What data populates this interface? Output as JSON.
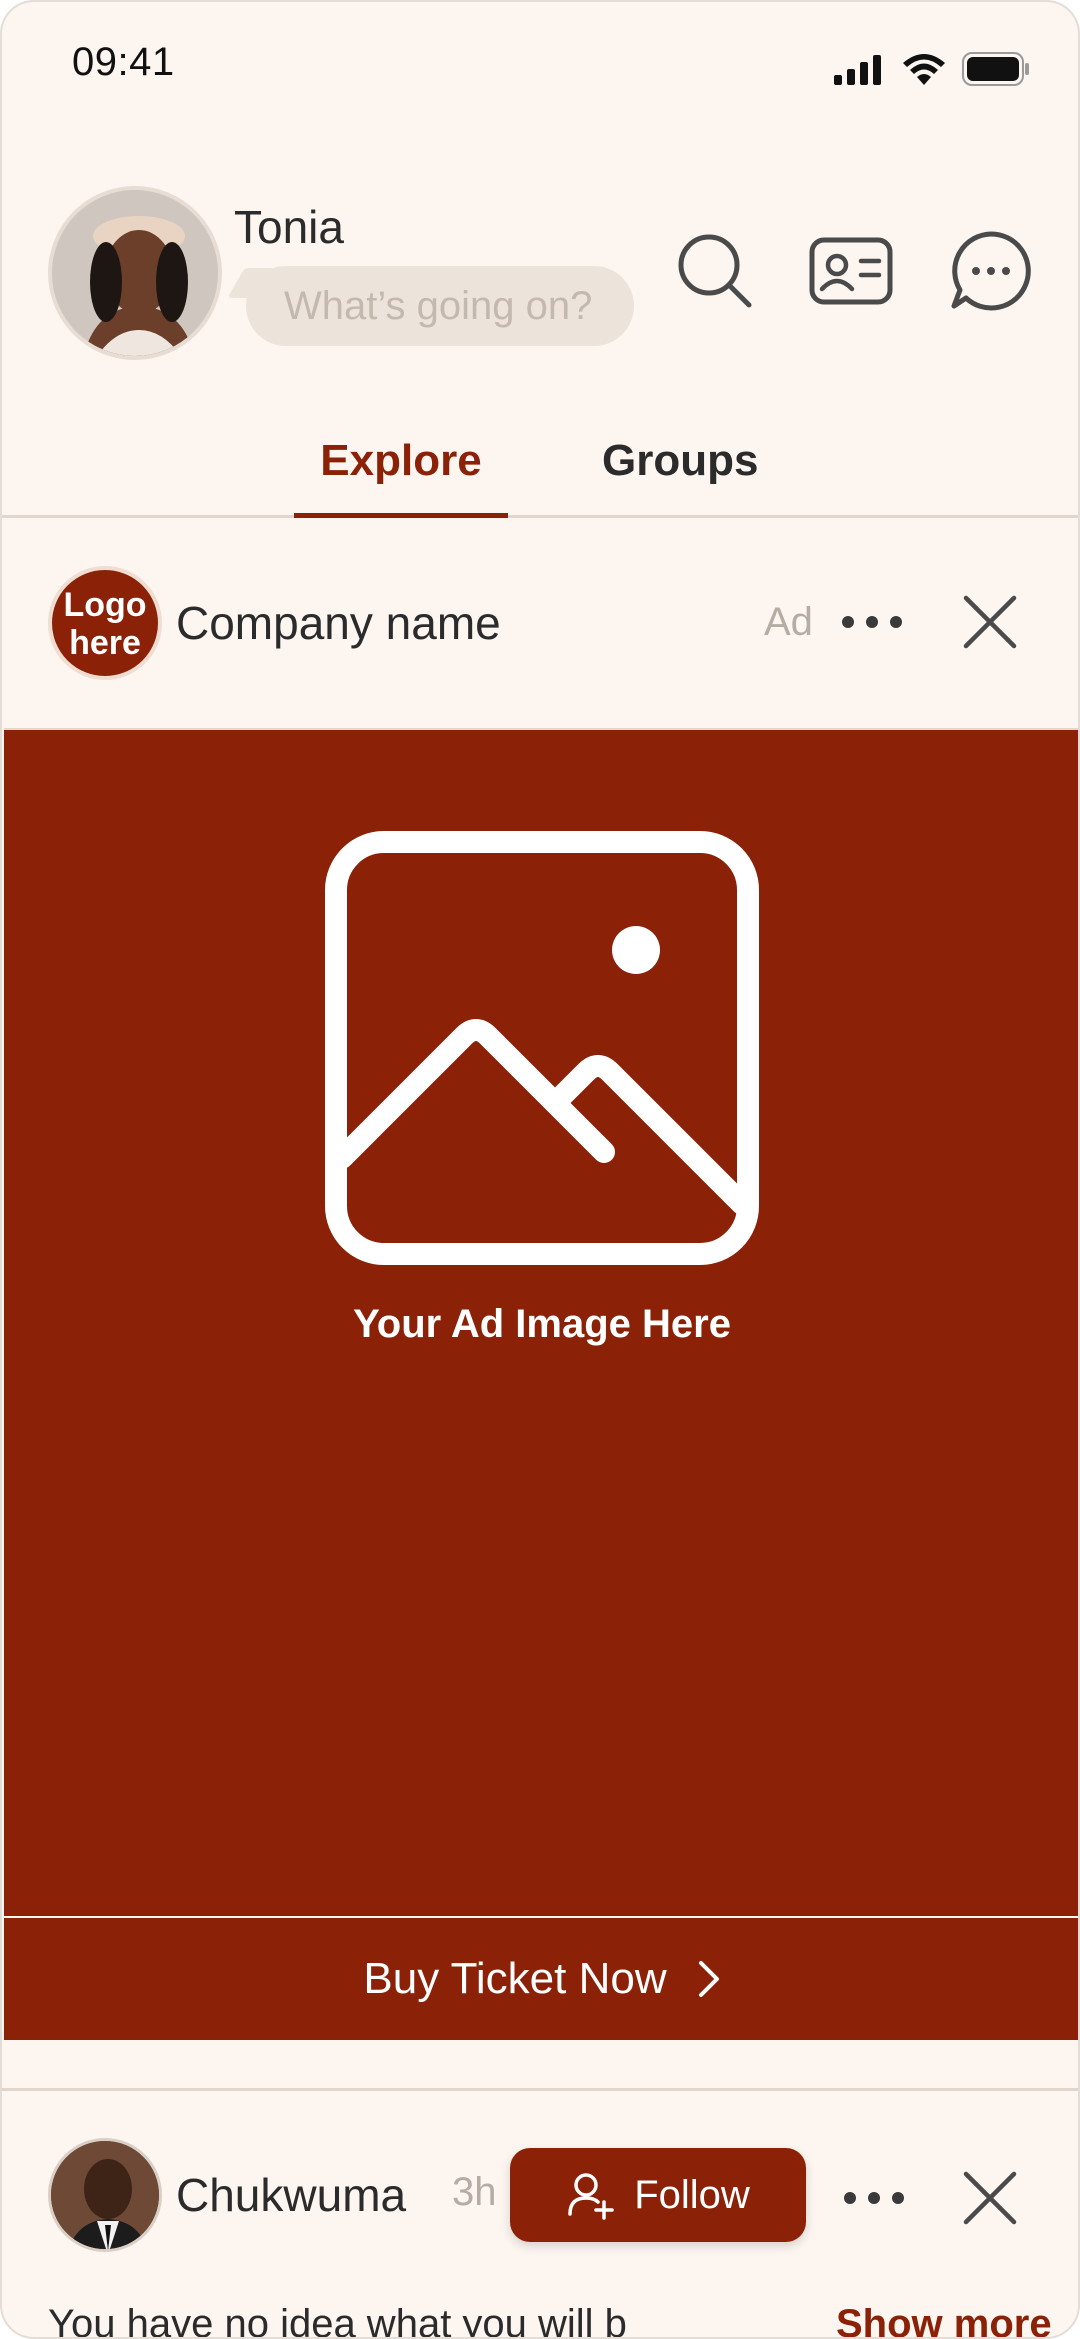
{
  "status_bar": {
    "time": "09:41",
    "icons": [
      "signal-icon",
      "wifi-icon",
      "battery-icon"
    ]
  },
  "header": {
    "username": "Tonia",
    "compose_placeholder": "What’s going on?",
    "icons": [
      "search-icon",
      "contact-card-icon",
      "chat-icon"
    ]
  },
  "tabs": [
    {
      "label": "Explore",
      "active": true
    },
    {
      "label": "Groups",
      "active": false
    }
  ],
  "ad": {
    "logo_text_line1": "Logo",
    "logo_text_line2": "here",
    "company_name": "Company name",
    "tag": "Ad",
    "image_caption": "Your Ad Image Here",
    "cta_label": "Buy Ticket Now"
  },
  "post": {
    "author": "Chukwuma",
    "time": "3h",
    "follow_label": "Follow",
    "text": "You have no idea what you will b",
    "show_more": "Show more"
  },
  "colors": {
    "accent": "#8b2208",
    "background": "#fcf5f0",
    "muted_text": "#b5aca4"
  }
}
